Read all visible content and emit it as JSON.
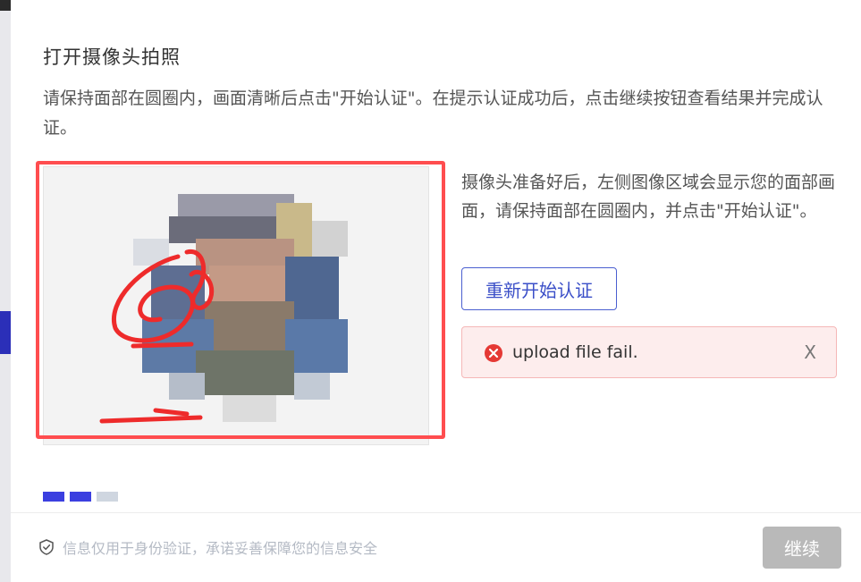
{
  "modal": {
    "title": "打开摄像头拍照",
    "instructions": "请保持面部在圆圈内，画面清晰后点击\"开始认证\"。在提示认证成功后，点击继续按钮查看结果并完成认证。"
  },
  "camera": {
    "side_text": "摄像头准备好后，左侧图像区域会显示您的面部画面，请保持面部在圆圈内，并点击\"开始认证\"。",
    "restart_label": "重新开始认证"
  },
  "alert": {
    "message": "upload file fail.",
    "close_label": "X",
    "icon": "error-circle-icon",
    "color": "#e53935"
  },
  "steps": [
    {
      "state": "done",
      "color": "#3b3fe0"
    },
    {
      "state": "done",
      "color": "#3b3fe0"
    },
    {
      "state": "pending",
      "color": "#cfd6e0"
    }
  ],
  "footer": {
    "security_text": "信息仅用于身份验证，承诺妥善保障您的信息安全",
    "continue_label": "继续"
  },
  "colors": {
    "accent": "#3b4fc8",
    "annotation": "#ff4d4f",
    "disabled": "#b9b9b9"
  }
}
